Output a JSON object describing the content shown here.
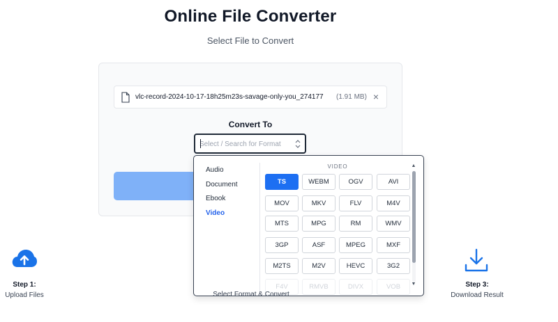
{
  "header": {
    "title": "Online File Converter",
    "subtitle": "Select File to Convert"
  },
  "file": {
    "name": "vlc-record-2024-10-17-18h25m23s-savage-only-you_274177",
    "size": "(1.91 MB)",
    "remove_icon": "×"
  },
  "convert": {
    "label": "Convert To",
    "placeholder": "Select / Search for Format"
  },
  "dropdown": {
    "categories": [
      {
        "label": "Audio",
        "active": false
      },
      {
        "label": "Document",
        "active": false
      },
      {
        "label": "Ebook",
        "active": false
      },
      {
        "label": "Video",
        "active": true
      }
    ],
    "section_label": "VIDEO",
    "formats": [
      "TS",
      "WEBM",
      "OGV",
      "AVI",
      "MOV",
      "MKV",
      "FLV",
      "M4V",
      "MTS",
      "MPG",
      "RM",
      "WMV",
      "3GP",
      "ASF",
      "MPEG",
      "MXF",
      "M2TS",
      "M2V",
      "HEVC",
      "3G2",
      "F4V",
      "RMVB",
      "DIVX",
      "VOB"
    ],
    "selected_format": "TS",
    "scroll_up_icon": "▲",
    "scroll_down_icon": "▼"
  },
  "steps": {
    "step1": {
      "title": "Step 1:",
      "desc": "Upload Files"
    },
    "step2": {
      "desc": "Select Format & Convert"
    },
    "step3": {
      "title": "Step 3:",
      "desc": "Download Result"
    }
  },
  "colors": {
    "accent": "#1d6ff2",
    "button_disabled": "#7fb1f8",
    "icon_blue": "#1a73e8"
  },
  "icons": {
    "file": "file-icon",
    "close": "close-icon",
    "select_arrows": "chevron-up-down-icon",
    "upload": "cloud-upload-icon",
    "download": "download-icon"
  }
}
